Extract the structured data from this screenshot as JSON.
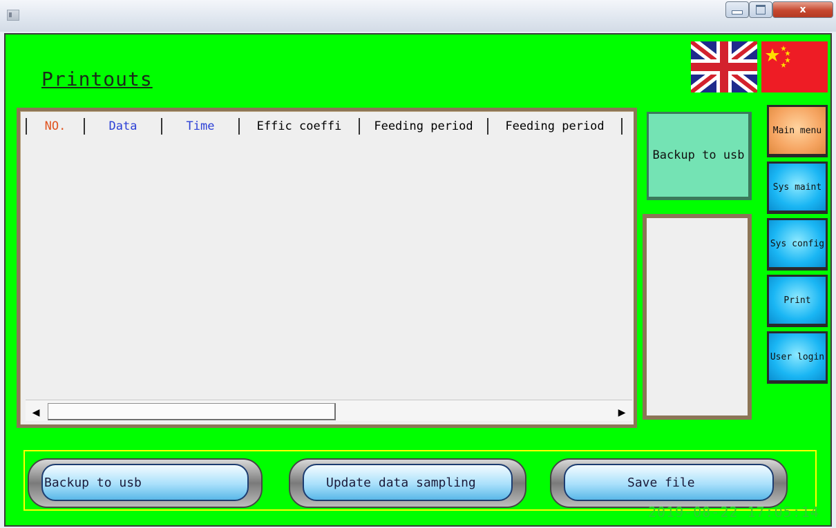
{
  "window": {
    "close_label": "x"
  },
  "page": {
    "title": "Printouts"
  },
  "table": {
    "columns": [
      {
        "label": "NO.",
        "color": "#e0531f"
      },
      {
        "label": "Data",
        "color": "#2b3fd6"
      },
      {
        "label": "Time",
        "color": "#2b3fd6"
      },
      {
        "label": "Effic coeffi",
        "color": "#111111"
      },
      {
        "label": "Feeding period",
        "color": "#111111"
      },
      {
        "label": "Feeding period",
        "color": "#111111"
      }
    ],
    "rows": []
  },
  "side": {
    "backup_label": "Backup to usb"
  },
  "nav": {
    "main_menu": "Main menu",
    "sys_maint": "Sys maint",
    "sys_config": "Sys config",
    "print": "Print",
    "user_login": "User login"
  },
  "actions": {
    "backup": "Backup to usb",
    "update": "Update data sampling",
    "save": "Save file"
  },
  "status": {
    "datetime": "2019-08-22 17:05:14"
  },
  "colors": {
    "background": "#00ff00",
    "frame": "#8c7556",
    "accent_orange": "#f6a562",
    "accent_blue": "#1ab6f4",
    "backup_green": "#74e3b4"
  },
  "icons": {
    "flag_english": "uk-flag-icon",
    "flag_chinese": "china-flag-icon"
  }
}
